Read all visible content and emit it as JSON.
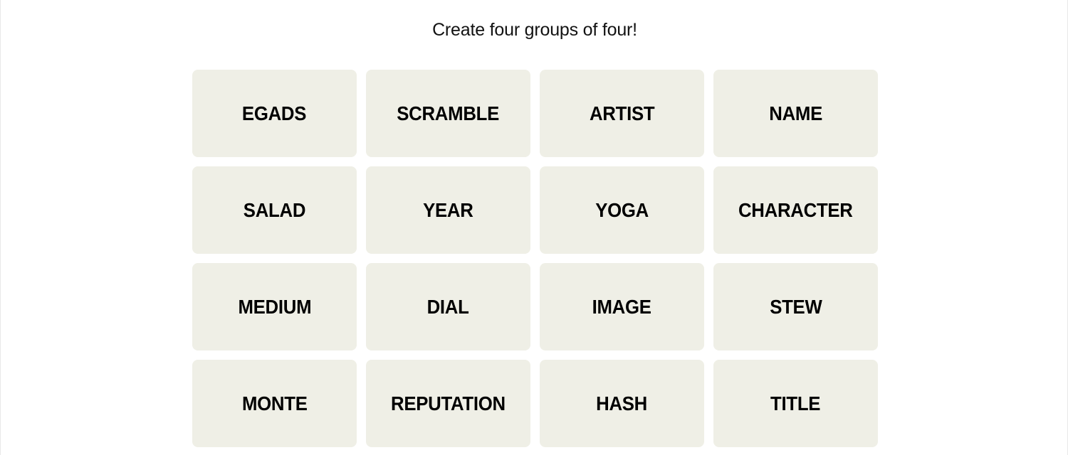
{
  "instructions": "Create four groups of four!",
  "tiles": [
    {
      "label": "EGADS"
    },
    {
      "label": "SCRAMBLE"
    },
    {
      "label": "ARTIST"
    },
    {
      "label": "NAME"
    },
    {
      "label": "SALAD"
    },
    {
      "label": "YEAR"
    },
    {
      "label": "YOGA"
    },
    {
      "label": "CHARACTER"
    },
    {
      "label": "MEDIUM"
    },
    {
      "label": "DIAL"
    },
    {
      "label": "IMAGE"
    },
    {
      "label": "STEW"
    },
    {
      "label": "MONTE"
    },
    {
      "label": "REPUTATION"
    },
    {
      "label": "HASH"
    },
    {
      "label": "TITLE"
    }
  ],
  "colors": {
    "tile_background": "#efefe6",
    "tile_text": "#000000",
    "page_background": "#ffffff"
  }
}
